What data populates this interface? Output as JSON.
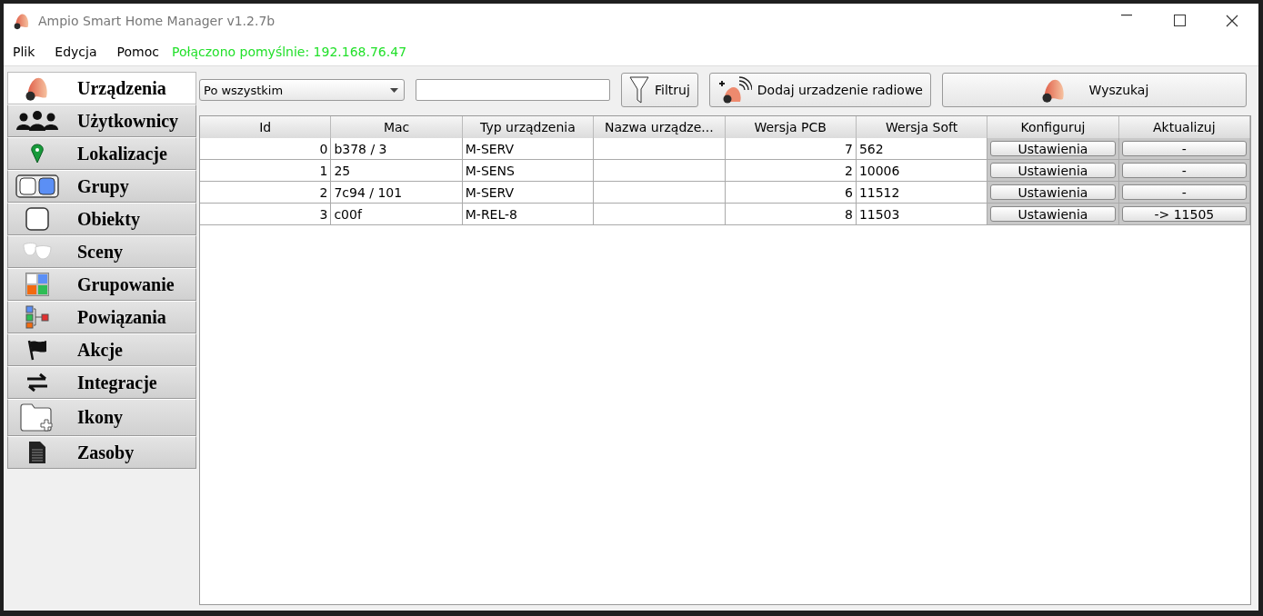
{
  "window": {
    "title": "Ampio Smart Home Manager v1.2.7b"
  },
  "menu": [
    "Plik",
    "Edycja",
    "Pomoc"
  ],
  "status": "Połączono pomyślnie: 192.168.76.47",
  "sidebar": {
    "items": [
      {
        "label": "Urządzenia",
        "selected": true
      },
      {
        "label": "Użytkownicy",
        "selected": false
      },
      {
        "label": "Lokalizacje",
        "selected": false
      },
      {
        "label": "Grupy",
        "selected": false
      },
      {
        "label": "Obiekty",
        "selected": false
      },
      {
        "label": "Sceny",
        "selected": false
      },
      {
        "label": "Grupowanie",
        "selected": false
      },
      {
        "label": "Powiązania",
        "selected": false
      },
      {
        "label": "Akcje",
        "selected": false
      },
      {
        "label": "Integracje",
        "selected": false
      },
      {
        "label": "Ikony",
        "selected": false
      },
      {
        "label": "Zasoby",
        "selected": false
      }
    ]
  },
  "toolbar": {
    "filter_select": "Po wszystkim",
    "filter_button": "Filtruj",
    "add_radio_button": "Dodaj urzadzenie radiowe",
    "search_button": "Wyszukaj"
  },
  "table": {
    "columns": [
      "Id",
      "Mac",
      "Typ urządzenia",
      "Nazwa urządze...",
      "Wersja PCB",
      "Wersja Soft",
      "Konfiguruj",
      "Aktualizuj"
    ],
    "rows": [
      {
        "id": "0",
        "mac": "b378 / 3",
        "type": "M-SERV",
        "name": "",
        "pcb": "7",
        "soft": "562",
        "configure": "Ustawienia",
        "update": "-"
      },
      {
        "id": "1",
        "mac": "25",
        "type": "M-SENS",
        "name": "",
        "pcb": "2",
        "soft": "10006",
        "configure": "Ustawienia",
        "update": "-"
      },
      {
        "id": "2",
        "mac": "7c94 / 101",
        "type": "M-SERV",
        "name": "",
        "pcb": "6",
        "soft": "11512",
        "configure": "Ustawienia",
        "update": "-"
      },
      {
        "id": "3",
        "mac": "c00f",
        "type": "M-REL-8",
        "name": "",
        "pcb": "8",
        "soft": "11503",
        "configure": "Ustawienia",
        "update": "-> 11505"
      }
    ]
  }
}
